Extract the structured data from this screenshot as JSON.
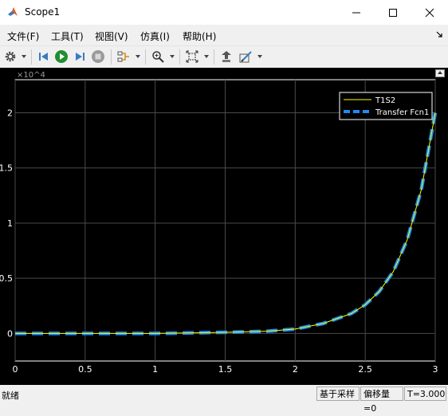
{
  "window": {
    "title": "Scope1",
    "icon": "matlab-icon",
    "controls": [
      "minimize-icon",
      "maximize-icon",
      "close-icon"
    ]
  },
  "menu": [
    {
      "label": "文件(F)"
    },
    {
      "label": "工具(T)"
    },
    {
      "label": "视图(V)"
    },
    {
      "label": "仿真(I)"
    },
    {
      "label": "帮助(H)"
    }
  ],
  "toolbar": {
    "icons": [
      "gear-icon",
      "step-back-icon",
      "run-icon",
      "step-forward-icon",
      "stop-icon",
      "signal-selector-icon",
      "zoom-icon",
      "fit-to-view-icon",
      "highlight-block-icon",
      "style-icon"
    ]
  },
  "colors": {
    "plot_background": "#000000",
    "axis_color": "#ffffff",
    "grid_color": "#4a4a4a",
    "series_t1s2": "#ffff00",
    "series_transfer_fcn": "#1e8cf0"
  },
  "chart_data": {
    "type": "line",
    "exponent_label": "×10^4",
    "xlim": [
      0,
      3
    ],
    "ylim": [
      -0.25,
      2.3
    ],
    "y_multiplier": 10000,
    "xticks": [
      0,
      0.5,
      1,
      1.5,
      2,
      2.5,
      3
    ],
    "xtick_labels": [
      "0",
      "0.5",
      "1",
      "1.5",
      "2",
      "2.5",
      "3"
    ],
    "yticks": [
      0,
      0.5,
      1,
      1.5,
      2
    ],
    "ytick_labels": [
      "0",
      "0.5",
      "1",
      "1.5",
      "2"
    ],
    "grid": true,
    "legend_position": "top-right",
    "series": [
      {
        "name": "T1S2",
        "style": "solid",
        "x": [
          0,
          0.5,
          1,
          1.5,
          1.8,
          2,
          2.2,
          2.4,
          2.5,
          2.6,
          2.7,
          2.8,
          2.9,
          3
        ],
        "y": [
          0,
          0,
          0,
          0.01,
          0.02,
          0.04,
          0.09,
          0.18,
          0.26,
          0.38,
          0.56,
          0.85,
          1.3,
          2.0
        ]
      },
      {
        "name": "Transfer Fcn1",
        "style": "dashed",
        "x": [
          0,
          0.5,
          1,
          1.5,
          1.8,
          2,
          2.2,
          2.4,
          2.5,
          2.6,
          2.7,
          2.8,
          2.9,
          3
        ],
        "y": [
          0,
          0,
          0,
          0.01,
          0.02,
          0.04,
          0.09,
          0.18,
          0.26,
          0.38,
          0.56,
          0.85,
          1.3,
          2.0
        ]
      }
    ]
  },
  "status": {
    "left": "就绪",
    "mode": "基于采样",
    "offset": "偏移量=0",
    "time": "T=3.000"
  }
}
